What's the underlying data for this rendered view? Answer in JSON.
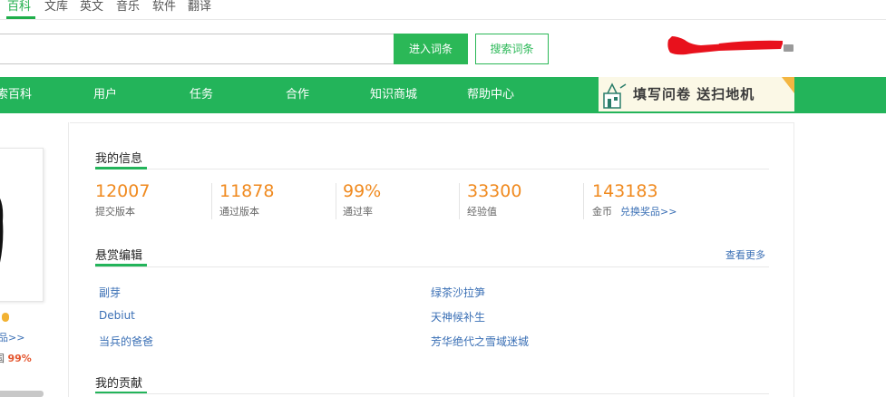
{
  "topnav": {
    "items": [
      "百科",
      "文库",
      "英文",
      "音乐",
      "软件",
      "翻译"
    ],
    "active_index": 0
  },
  "search": {
    "value": "",
    "enter_label": "进入词条",
    "search_label": "搜索词条"
  },
  "mainnav": {
    "items": [
      "索百科",
      "用户",
      "任务",
      "合作",
      "知识商城",
      "帮助中心"
    ]
  },
  "banner": {
    "text": "填写问卷 送扫地机"
  },
  "sidebar": {
    "link": "品>>",
    "rate_prefix": "国",
    "rate_value": "99%"
  },
  "my_info": {
    "title": "我的信息",
    "stats": [
      {
        "value": "12007",
        "label": "提交版本"
      },
      {
        "value": "11878",
        "label": "通过版本"
      },
      {
        "value": "99%",
        "label": "通过率"
      },
      {
        "value": "33300",
        "label": "经验值"
      },
      {
        "value": "143183",
        "label": "金币"
      }
    ],
    "redeem_link": "兑换奖品>>"
  },
  "bounty": {
    "title": "悬赏编辑",
    "more_label": "查看更多",
    "entries_left": [
      "副芽",
      "Debiut",
      "当兵的爸爸"
    ],
    "entries_right": [
      "绿茶沙拉笋",
      "天神候补生",
      "芳华绝代之雪域迷城"
    ]
  },
  "contribution": {
    "title": "我的贡献"
  },
  "colors": {
    "brand_green": "#23b45a",
    "stat_orange": "#f08a1f",
    "link_blue": "#3a6fb5"
  }
}
